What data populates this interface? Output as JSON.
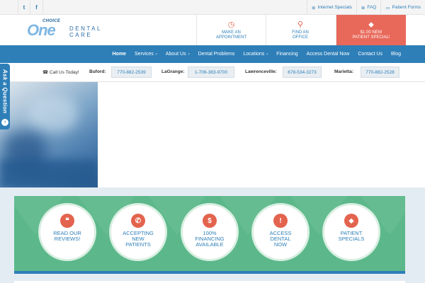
{
  "topbar": {
    "social": [
      {
        "name": "twitter-icon",
        "glyph": "t"
      },
      {
        "name": "facebook-icon",
        "glyph": "f"
      }
    ],
    "links": [
      {
        "icon": "⊕",
        "label": "Internet Specials"
      },
      {
        "icon": "⊕",
        "label": "FAQ"
      },
      {
        "icon": "▭",
        "label": "Patient Forms"
      }
    ]
  },
  "header": {
    "logo": {
      "choice": "CHOICE",
      "one": "One",
      "dental": "DENTAL",
      "care": "CARE"
    },
    "appointment": {
      "icon": "◷",
      "line1": "MAKE AN",
      "line2": "APPOINTMENT"
    },
    "office": {
      "icon": "⚲",
      "line1": "FIND AN",
      "line2": "OFFICE"
    },
    "special": {
      "icon": "⬥",
      "line1": "$1.00 NEW",
      "line2": "PATIENT SPECIAL!"
    }
  },
  "nav": {
    "items": [
      {
        "label": "Home",
        "caret": ""
      },
      {
        "label": "Services",
        "caret": "›"
      },
      {
        "label": "About Us",
        "caret": "›"
      },
      {
        "label": "Dental Problems",
        "caret": ""
      },
      {
        "label": "Locations",
        "caret": "›"
      },
      {
        "label": "Financing",
        "caret": ""
      },
      {
        "label": "Access Dental Now",
        "caret": ""
      },
      {
        "label": "Contact Us",
        "caret": ""
      },
      {
        "label": "Blog",
        "caret": ""
      }
    ]
  },
  "phones": {
    "call_label": "☎ Call Us Today!",
    "locations": [
      {
        "city": "Buford:",
        "phone": "770-882-2539"
      },
      {
        "city": "LaGrange:",
        "phone": "1-706-383-9700"
      },
      {
        "city": "Lawrenceville:",
        "phone": "678-534-3273"
      },
      {
        "city": "Marietta:",
        "phone": "770-882-2528"
      }
    ]
  },
  "ask": {
    "label": "Ask a Question",
    "icon": "›"
  },
  "features": [
    {
      "icon": "❝",
      "line1": "READ OUR",
      "line2": "REVIEWS!",
      "line3": ""
    },
    {
      "icon": "✆",
      "line1": "ACCEPTING",
      "line2": "NEW",
      "line3": "PATIENTS"
    },
    {
      "icon": "$",
      "line1": "100%",
      "line2": "FINANCING",
      "line3": "AVAILABLE"
    },
    {
      "icon": "!",
      "line1": "ACCESS",
      "line2": "DENTAL",
      "line3": "NOW"
    },
    {
      "icon": "⬥",
      "line1": "PATIENT",
      "line2": "SPECIALS",
      "line3": ""
    }
  ],
  "colors": {
    "brand_blue": "#2e7fb8",
    "accent_red": "#e8685a",
    "band_green": "#5cb88a"
  }
}
